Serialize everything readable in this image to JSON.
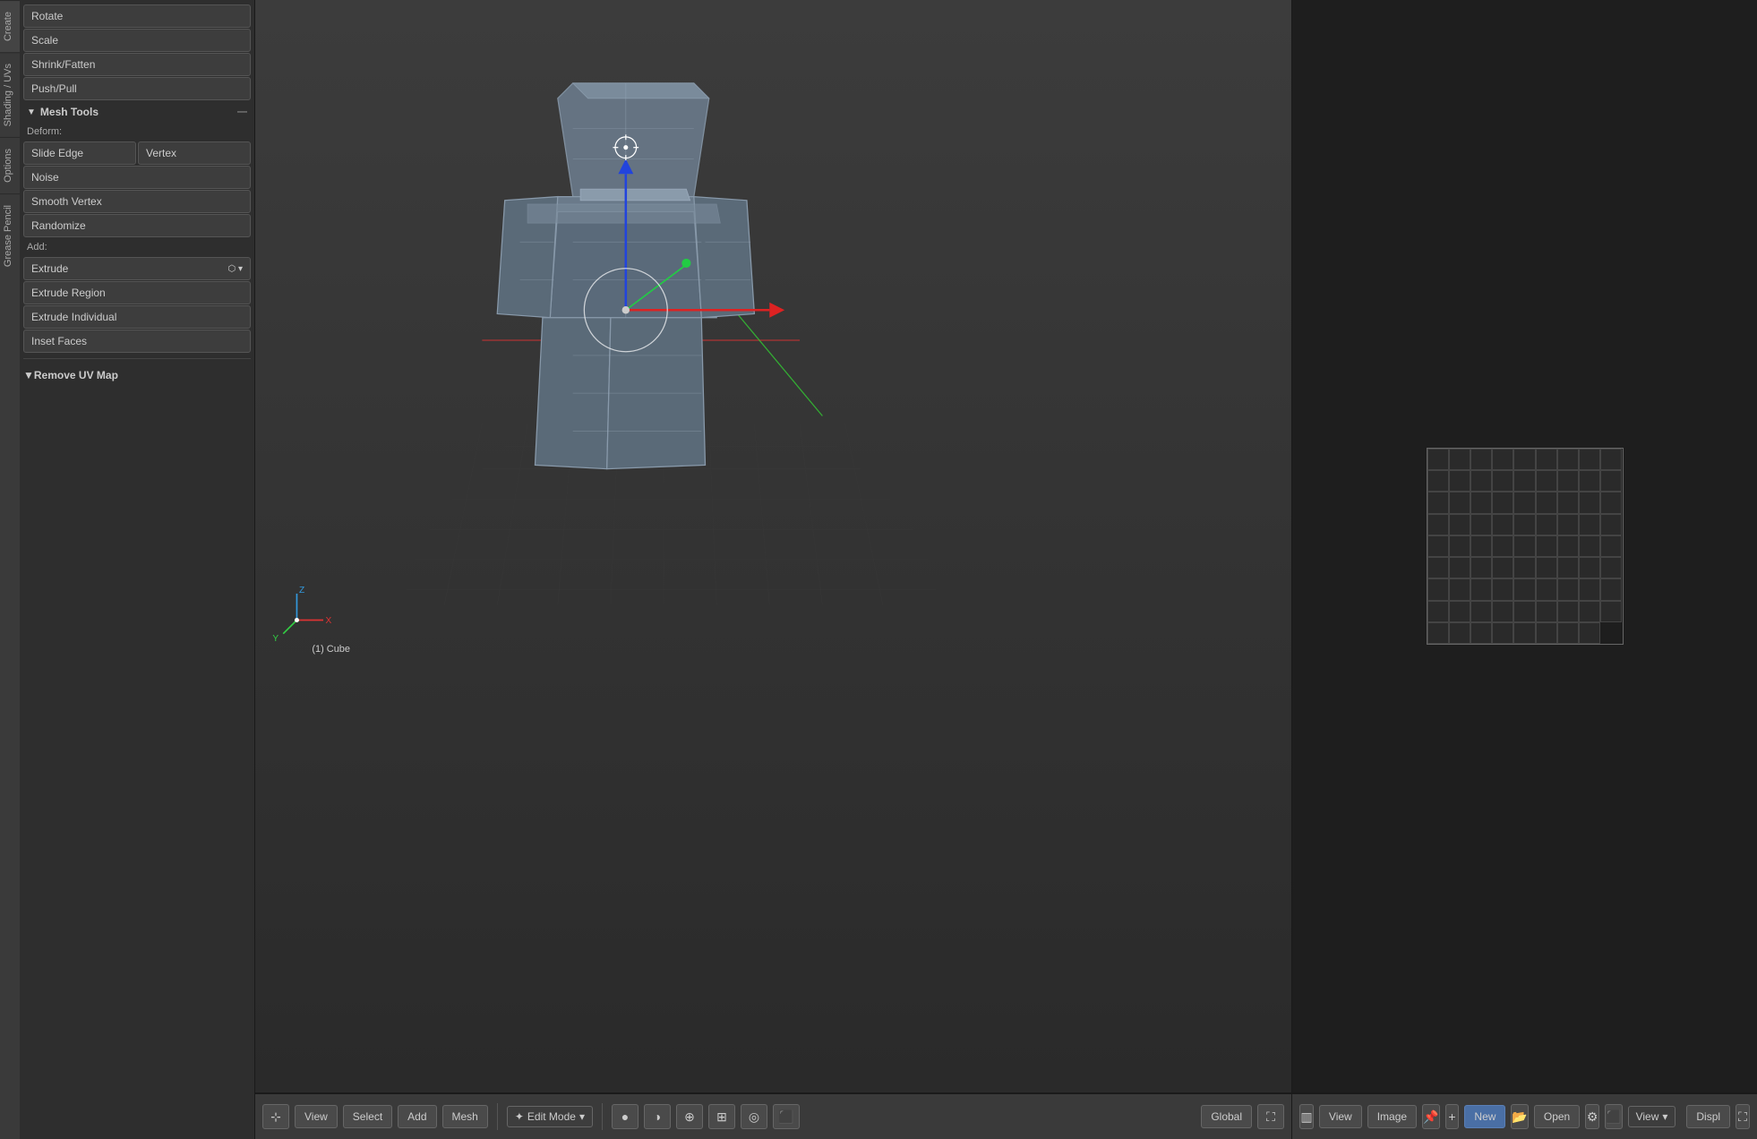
{
  "app": {
    "title": "Blender"
  },
  "left_panel": {
    "vertical_tabs": [
      {
        "id": "create",
        "label": "Create"
      },
      {
        "id": "shading_uvs",
        "label": "Shading / UVs"
      },
      {
        "id": "options",
        "label": "Options"
      },
      {
        "id": "grease_pencil",
        "label": "Grease Pencil"
      }
    ],
    "sections": {
      "mesh_tools": {
        "header": "Mesh Tools",
        "arrow": "▼",
        "deform_label": "Deform:",
        "deform_buttons": [
          {
            "id": "slide-edge",
            "label": "Slide Edge"
          },
          {
            "id": "vertex",
            "label": "Vertex"
          }
        ],
        "single_buttons": [
          {
            "id": "noise",
            "label": "Noise"
          },
          {
            "id": "smooth-vertex",
            "label": "Smooth Vertex"
          },
          {
            "id": "randomize",
            "label": "Randomize"
          }
        ],
        "add_label": "Add:",
        "extrude_dropdown": "Extrude",
        "add_buttons": [
          {
            "id": "extrude-region",
            "label": "Extrude Region"
          },
          {
            "id": "extrude-individual",
            "label": "Extrude Individual"
          },
          {
            "id": "inset-faces",
            "label": "Inset Faces"
          }
        ]
      },
      "top_buttons": [
        {
          "id": "rotate",
          "label": "Rotate"
        },
        {
          "id": "scale",
          "label": "Scale"
        },
        {
          "id": "shrink-fatten",
          "label": "Shrink/Fatten"
        },
        {
          "id": "push-pull",
          "label": "Push/Pull"
        }
      ],
      "remove_uv": {
        "arrow": "▼",
        "label": "Remove UV Map"
      }
    }
  },
  "viewport": {
    "object_label": "(1) Cube",
    "mode": "Edit Mode",
    "orientation": "Global",
    "bottom_bar": {
      "view_btn": "View",
      "select_btn": "Select",
      "add_btn": "Add",
      "mesh_btn": "Mesh",
      "mode_label": "Edit Mode",
      "global_label": "Global"
    }
  },
  "right_panel": {
    "bottom_bar": {
      "view_btn": "View",
      "image_btn": "Image",
      "new_btn": "New",
      "open_btn": "Open",
      "view_mode": "View",
      "disp_label": "Displ"
    }
  },
  "axes": {
    "x_label": "X",
    "y_label": "Y",
    "z_label": "Z"
  }
}
